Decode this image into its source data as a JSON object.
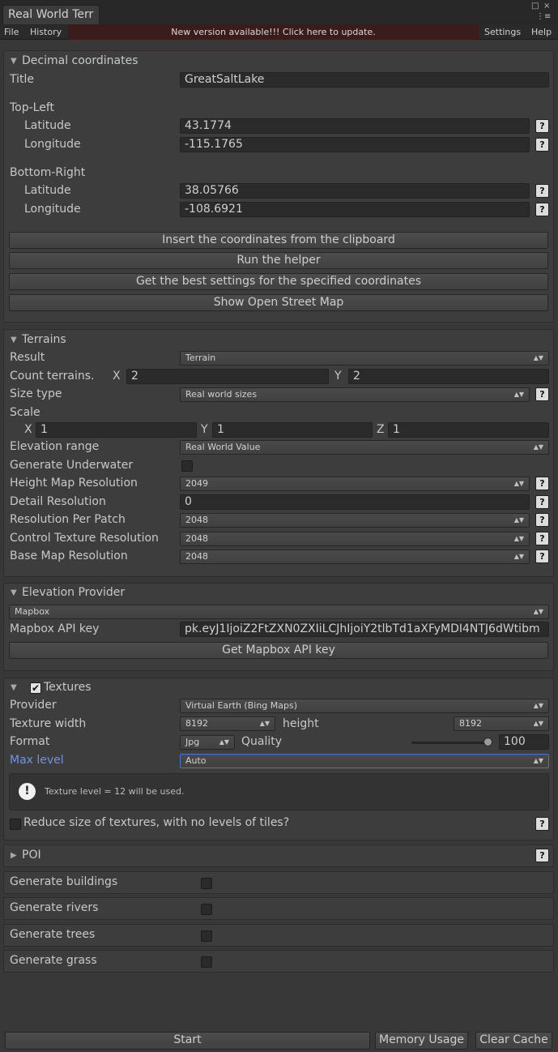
{
  "window": {
    "tab_title": "Real World Terr",
    "menu_file": "File",
    "menu_history": "History",
    "update_banner": "New version available!!! Click here to update.",
    "menu_settings": "Settings",
    "menu_help": "Help",
    "maximize_glyph": "□",
    "close_glyph": "×",
    "options_glyph": "⋮≡"
  },
  "decimal": {
    "header": "Decimal coordinates",
    "title_label": "Title",
    "title_value": "GreatSaltLake",
    "top_left_label": "Top-Left",
    "latitude_label": "Latitude",
    "longitude_label": "Longitude",
    "tl_latitude": "43.1774",
    "tl_longitude": "-115.1765",
    "bottom_right_label": "Bottom-Right",
    "br_latitude": "38.05766",
    "br_longitude": "-108.6921",
    "btn_clipboard": "Insert the coordinates from the clipboard",
    "btn_helper": "Run the helper",
    "btn_best_settings": "Get the best settings for the specified coordinates",
    "btn_osm": "Show Open Street Map"
  },
  "terrains": {
    "header": "Terrains",
    "result_label": "Result",
    "result_value": "Terrain",
    "count_label": "Count terrains.",
    "x_label": "X",
    "y_label": "Y",
    "z_label": "Z",
    "count_x": "2",
    "count_y": "2",
    "size_type_label": "Size type",
    "size_type_value": "Real world sizes",
    "scale_label": "Scale",
    "scale_x": "1",
    "scale_y": "1",
    "scale_z": "1",
    "elevation_range_label": "Elevation range",
    "elevation_range_value": "Real World Value",
    "generate_underwater_label": "Generate Underwater",
    "heightmap_label": "Height Map Resolution",
    "heightmap_value": "2049",
    "detail_label": "Detail Resolution",
    "detail_value": "0",
    "per_patch_label": "Resolution Per Patch",
    "per_patch_value": "2048",
    "control_label": "Control Texture Resolution",
    "control_value": "2048",
    "basemap_label": "Base Map Resolution",
    "basemap_value": "2048"
  },
  "elevation": {
    "header": "Elevation Provider",
    "provider_value": "Mapbox",
    "api_key_label": "Mapbox API key",
    "api_key_value": "pk.eyJ1IjoiZ2FtZXN0ZXIiLCJhIjoiY2tlbTd1aXFyMDI4NTJ6dWtibm",
    "btn_get_key": "Get Mapbox API key"
  },
  "textures": {
    "header": "Textures",
    "provider_label": "Provider",
    "provider_value": "Virtual Earth (Bing Maps)",
    "width_label": "Texture width",
    "width_value": "8192",
    "height_label": "height",
    "height_value": "8192",
    "format_label": "Format",
    "format_value": "Jpg",
    "quality_label": "Quality",
    "quality_value": "100",
    "quality_fraction": 1.0,
    "max_level_label": "Max level",
    "max_level_value": "Auto",
    "info_text": "Texture level = 12 will be used.",
    "reduce_label": "Reduce size of textures, with no levels of tiles?"
  },
  "poi": {
    "header": "POI"
  },
  "generate": {
    "buildings": "Generate buildings",
    "rivers": "Generate rivers",
    "trees": "Generate trees",
    "grass": "Generate grass"
  },
  "footer": {
    "start": "Start",
    "memory": "Memory Usage",
    "clear_cache": "Clear Cache"
  },
  "glyphs": {
    "help": "?",
    "dropdown_arrow": "▲▼",
    "expanded": "▼",
    "collapsed": "▶",
    "check": "✔",
    "info": "!"
  },
  "colors": {
    "accent_blue": "#6f93e8",
    "focus_border": "#4a73c9",
    "update_banner_bg": "#3a1c1c"
  }
}
